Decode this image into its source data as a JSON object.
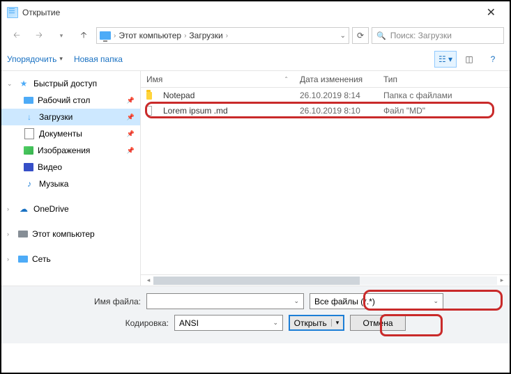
{
  "window": {
    "title": "Открытие"
  },
  "breadcrumb": {
    "pc": "Этот компьютер",
    "folder": "Загрузки"
  },
  "search": {
    "placeholder": "Поиск: Загрузки"
  },
  "toolbar": {
    "organize": "Упорядочить",
    "newfolder": "Новая папка"
  },
  "sidebar": {
    "quick": "Быстрый доступ",
    "desktop": "Рабочий стол",
    "downloads": "Загрузки",
    "documents": "Документы",
    "pictures": "Изображения",
    "videos": "Видео",
    "music": "Музыка",
    "onedrive": "OneDrive",
    "thispc": "Этот компьютер",
    "network": "Сеть"
  },
  "columns": {
    "name": "Имя",
    "date": "Дата изменения",
    "type": "Тип"
  },
  "files": [
    {
      "name": "Notepad",
      "date": "26.10.2019 8:14",
      "type": "Папка с файлами",
      "kind": "folder"
    },
    {
      "name": "Lorem ipsum .md",
      "date": "26.10.2019 8:10",
      "type": "Файл \"MD\"",
      "kind": "file"
    }
  ],
  "bottom": {
    "filename_label": "Имя файла:",
    "filename_value": "",
    "filetype": "Все файлы  (*.*)",
    "encoding_label": "Кодировка:",
    "encoding_value": "ANSI",
    "open": "Открыть",
    "cancel": "Отмена"
  }
}
